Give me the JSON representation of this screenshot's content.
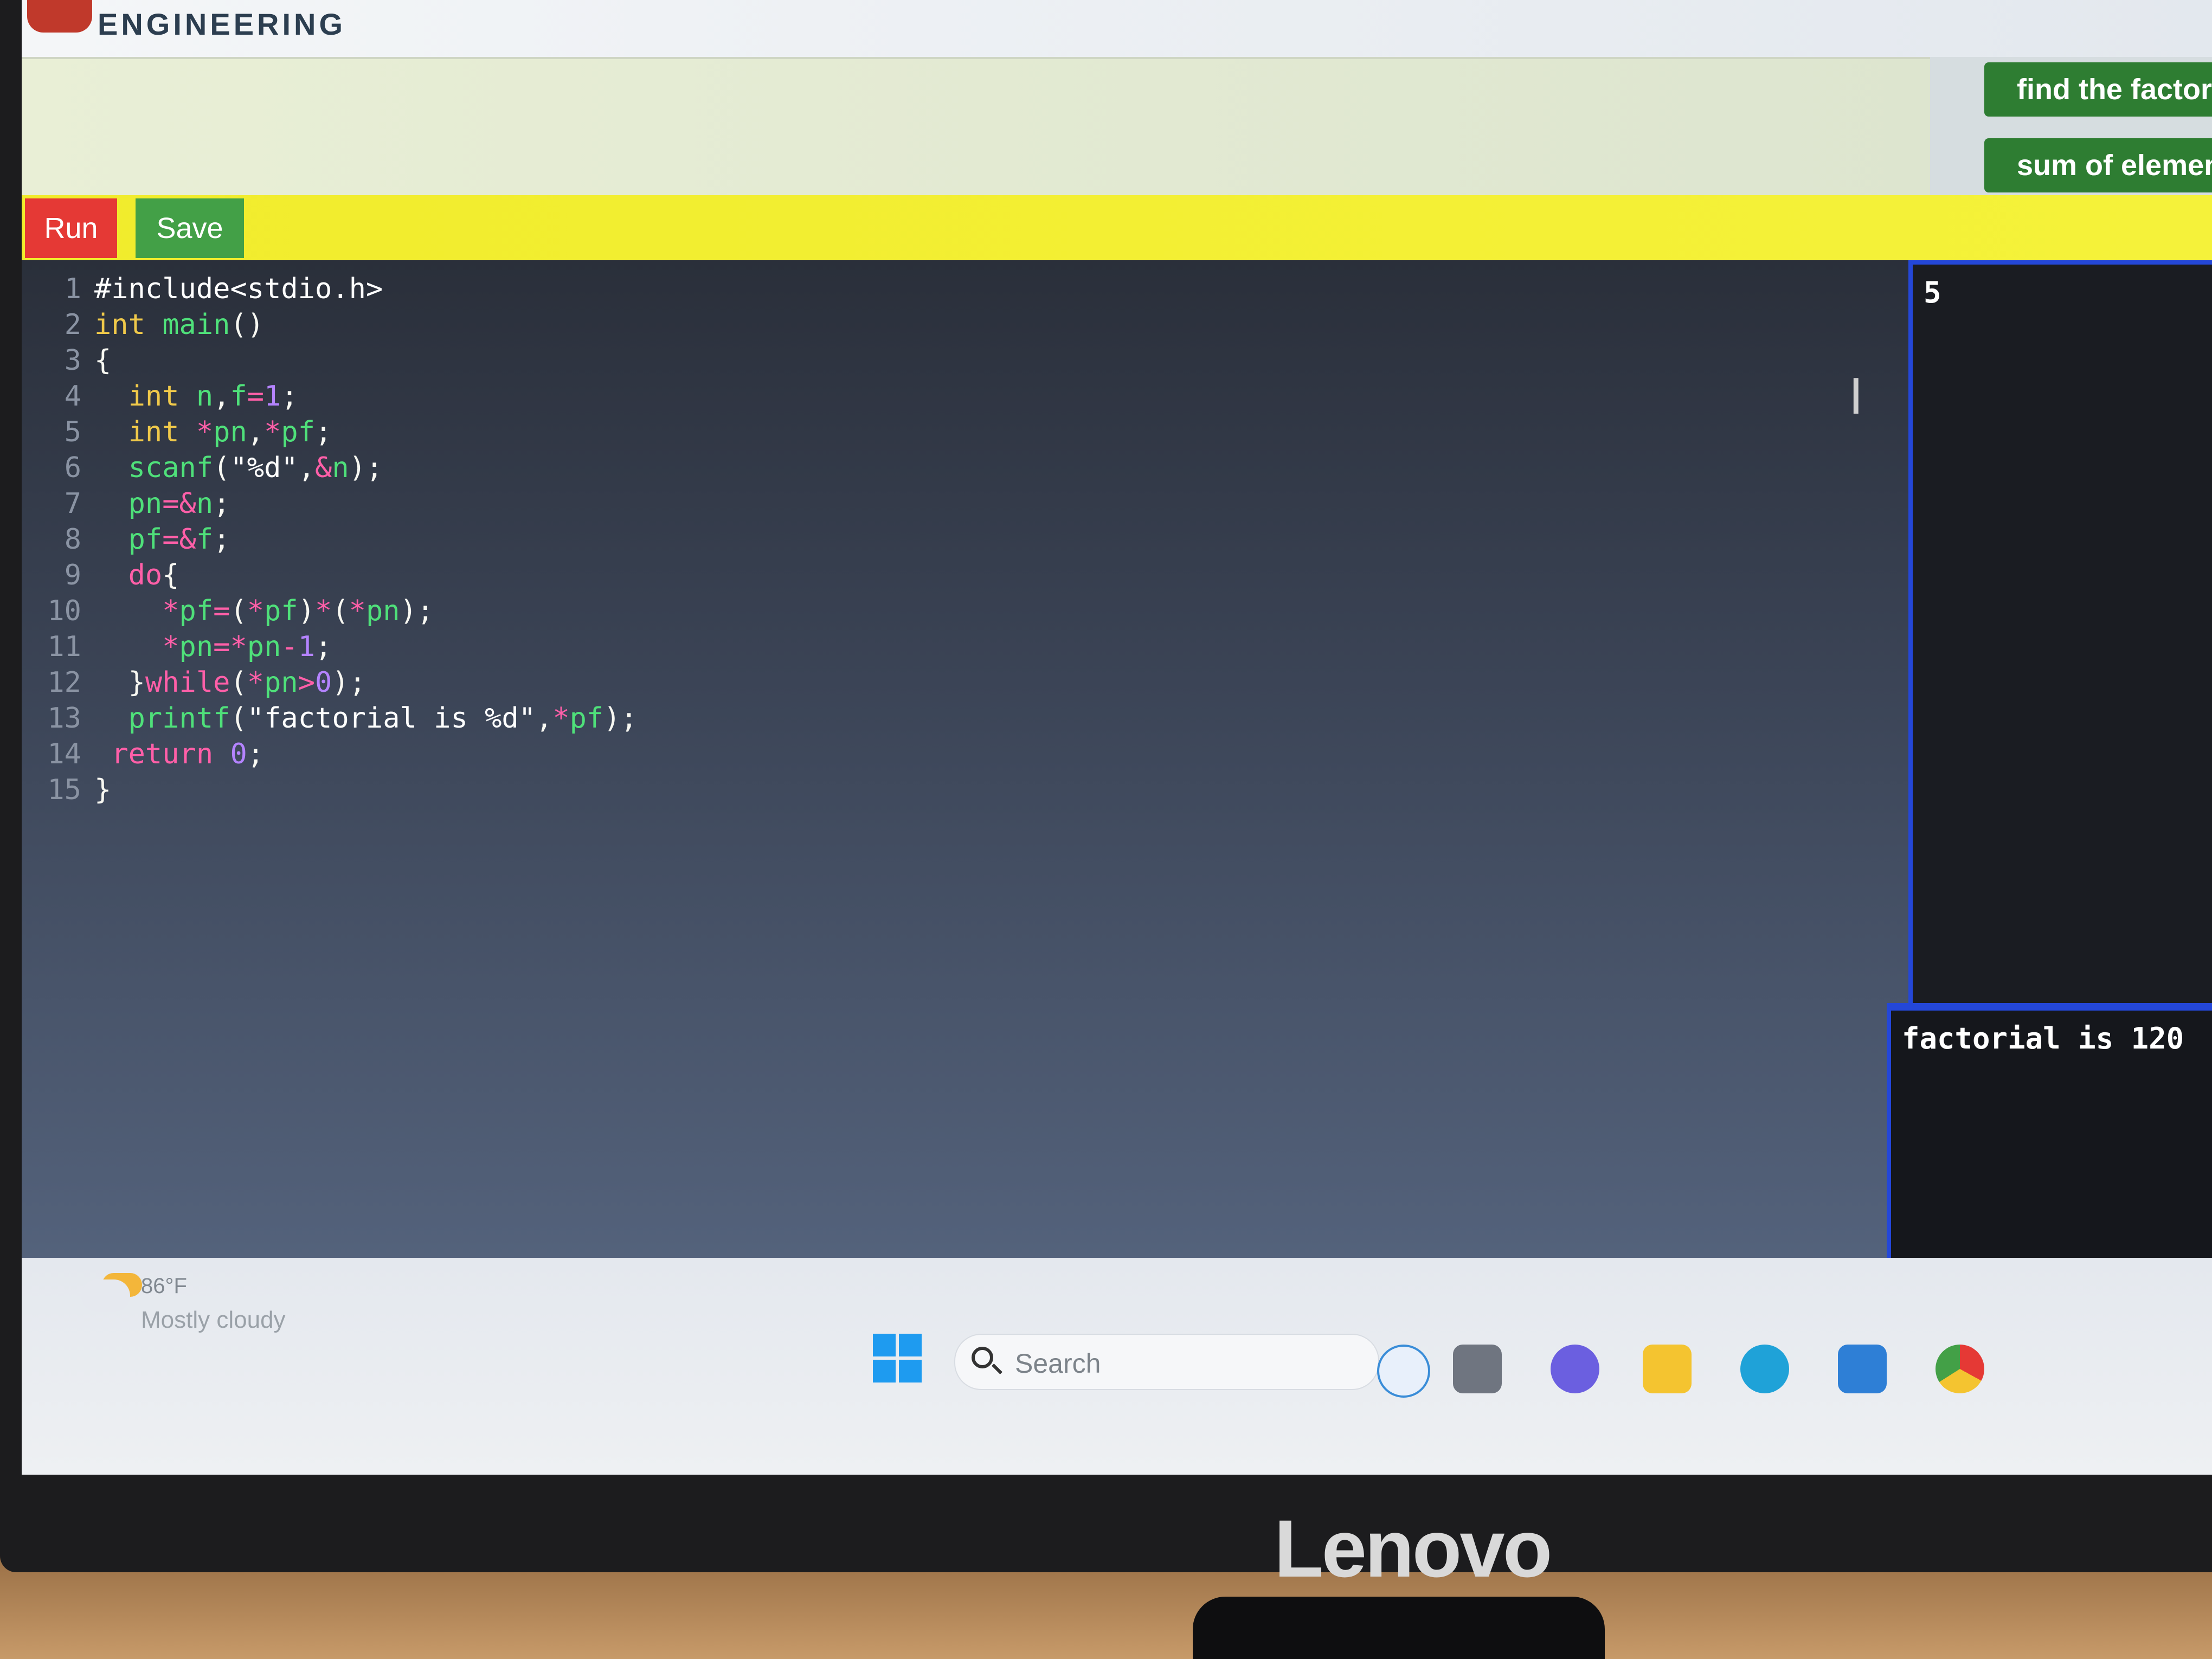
{
  "header": {
    "logo_text": "ENGINEERING",
    "side_buttons": [
      "find the factoria",
      "sum of elements"
    ]
  },
  "toolbar": {
    "run_label": "Run",
    "save_label": "Save"
  },
  "editor": {
    "line_numbers": [
      "1",
      "2",
      "3",
      "4",
      "5",
      "6",
      "7",
      "8",
      "9",
      "10",
      "11",
      "12",
      "13",
      "14",
      "15"
    ]
  },
  "input_pane": {
    "text": "5"
  },
  "output_pane": {
    "text": "factorial is 120"
  },
  "taskbar": {
    "weather_temp": "86°F",
    "weather_desc": "Mostly cloudy",
    "search_placeholder": "Search",
    "icons": [
      "windows-start-icon",
      "search-icon",
      "bing-icon",
      "task-view-icon",
      "chat-icon",
      "file-explorer-icon",
      "edge-icon",
      "store-icon",
      "chrome-icon"
    ]
  },
  "monitor": {
    "brand": "Lenovo"
  }
}
